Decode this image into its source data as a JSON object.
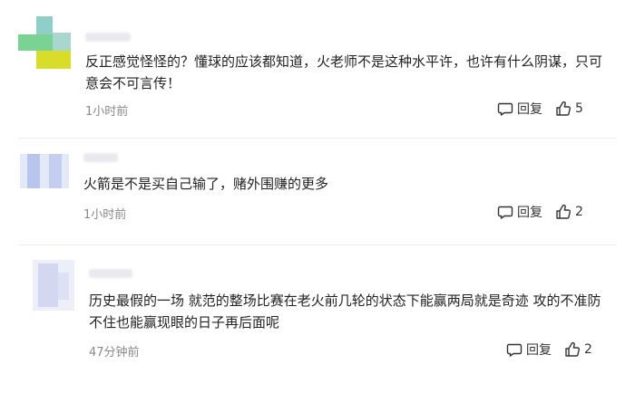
{
  "comments": [
    {
      "text": "反正感觉怪怪的？懂球的应该都知道，火老师不是这种水平许，也许有什么阴谋，只可\n意会不可言传！",
      "time": "1小时前",
      "reply_label": "回复",
      "likes": "5",
      "avatar_colors": [
        "#8ed0c8",
        "#79d392",
        "#d8dd2a"
      ]
    },
    {
      "text": "火箭是不是买自己输了，赌外围赚的更多",
      "time": "1小时前",
      "reply_label": "回复",
      "likes": "2",
      "avatar_colors": [
        "#b8c6ee",
        "#e4e9f7"
      ]
    },
    {
      "text": "历史最假的一场 就范的整场比赛在老火前几轮的状态下能赢两局就是奇迹 攻的不准防\n不住也能赢现眼的日子再后面呢",
      "time": "47分钟前",
      "reply_label": "回复",
      "likes": "2",
      "avatar_colors": [
        "#d3d8f0",
        "#eceef8"
      ]
    }
  ],
  "icons": {
    "reply": "comment-bubble-icon",
    "like": "thumbs-up-icon"
  }
}
